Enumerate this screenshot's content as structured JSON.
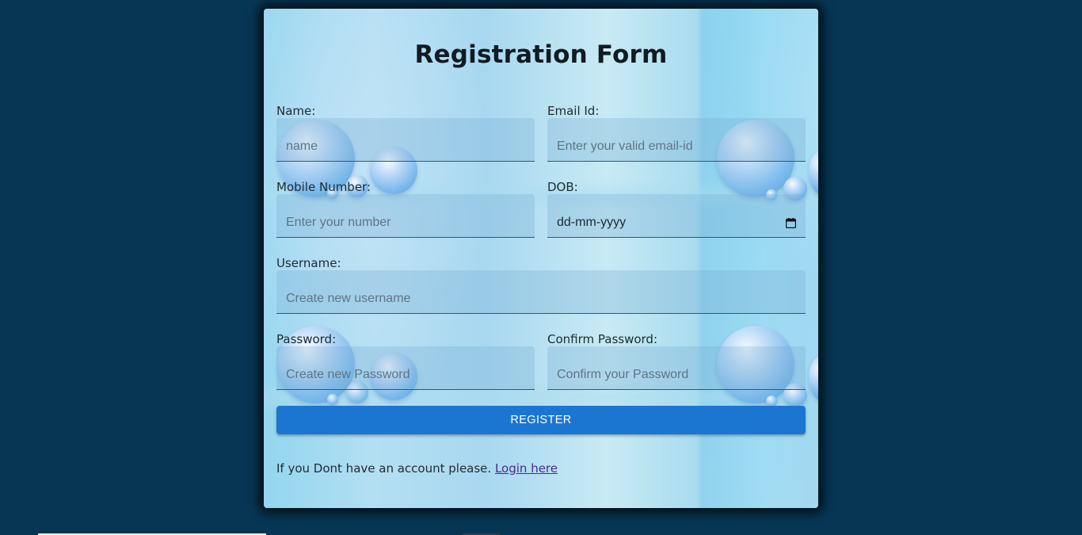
{
  "page": {
    "background": "#073655",
    "accent": "#1b76d2"
  },
  "form": {
    "title": "Registration Form",
    "fields": {
      "name": {
        "label": "Name:",
        "placeholder": "name"
      },
      "email": {
        "label": "Email Id:",
        "placeholder": "Enter your valid email-id"
      },
      "mobile": {
        "label": "Mobile Number:",
        "placeholder": "Enter your number"
      },
      "dob": {
        "label": "DOB:",
        "value": "dd-mm-yyyy",
        "icon": "calendar-icon"
      },
      "username": {
        "label": "Username:",
        "placeholder": "Create new username"
      },
      "password": {
        "label": "Password:",
        "placeholder": "Create new Password"
      },
      "confirm_password": {
        "label": "Confirm Password:",
        "placeholder": "Confirm your Password"
      }
    },
    "register_label": "REGISTER",
    "footer": {
      "text": "If you Dont have an account please.",
      "link_label": "Login here"
    }
  }
}
